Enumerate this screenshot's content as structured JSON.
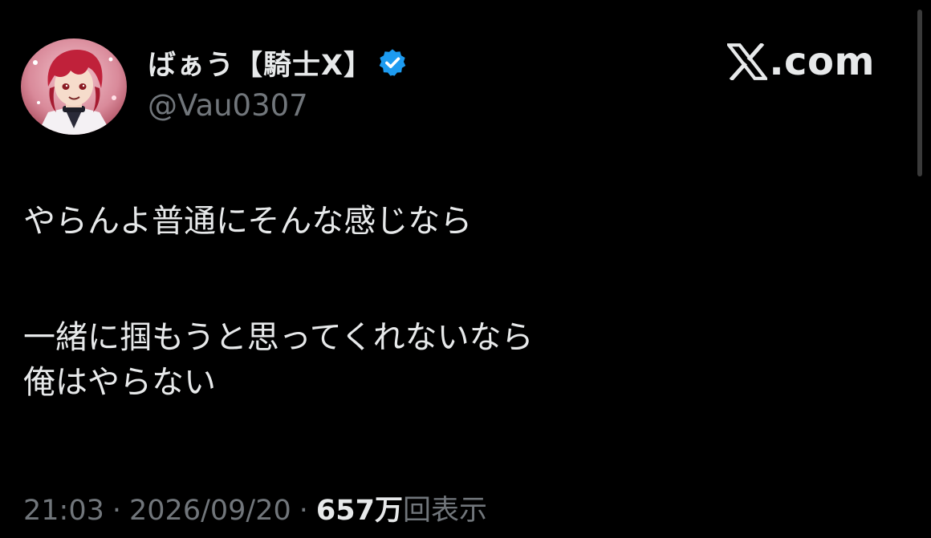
{
  "user": {
    "display_name": "ばぁう【騎士X】",
    "handle": "@Vau0307",
    "verified_badge_icon": "verified-badge-icon",
    "avatar_icon": "red-haired-anime-character-avatar"
  },
  "brand": {
    "logo_icon": "x-logo-icon",
    "text": ".com"
  },
  "tweet": {
    "lines": [
      "やらんよ普通にそんな感じなら",
      "一緒に掴もうと思ってくれないなら",
      "俺はやらない"
    ]
  },
  "meta": {
    "time": "21:03",
    "separator": "·",
    "date": "2026/09/20",
    "views_count": "657万",
    "views_label": "回表示"
  },
  "colors": {
    "background": "#000000",
    "text": "#e7e9ea",
    "secondary_text": "#71767b",
    "verified_blue": "#1d9bf0"
  }
}
